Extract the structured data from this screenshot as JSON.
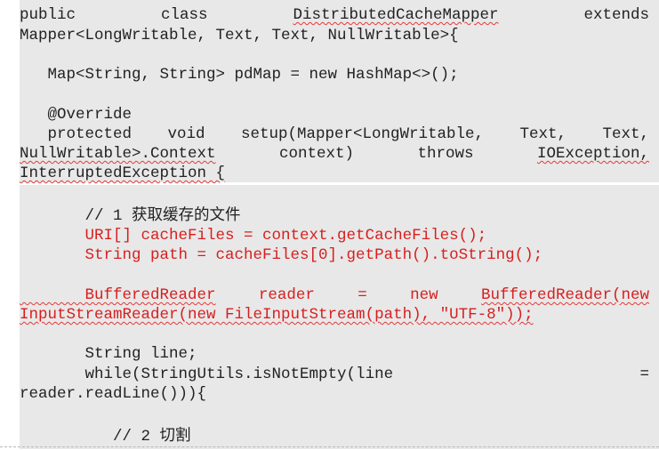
{
  "code": {
    "l1": {
      "a": "public",
      "b": "class",
      "c": "DistributedCacheMapper",
      "d": "extends"
    },
    "l2": "Mapper<LongWritable, Text, Text, NullWritable>{",
    "l3": "   Map<String, String> pdMap = new HashMap<>();",
    "l4": "   @Override",
    "l5": {
      "a": "   protected",
      "b": "void",
      "c": "setup(Mapper<LongWritable,",
      "d": "Text,",
      "e": "Text,"
    },
    "l6": {
      "a": "NullWritable>.Context",
      "b": "context)",
      "c": "throws",
      "d": "IOException,"
    },
    "l7": "InterruptedException {",
    "l8": "       // 1 获取缓存的文件",
    "l9": "       URI[] cacheFiles = context.getCacheFiles();",
    "l10": "       String path = cacheFiles[0].getPath().toString();",
    "l11": {
      "a": "       BufferedReader",
      "b": "reader",
      "c": "=",
      "d": "new",
      "e": "BufferedReader(new"
    },
    "l12": "InputStreamReader(new FileInputStream(path), \"UTF-8\"));",
    "l13": "       String line;",
    "l14": {
      "a": "       while(StringUtils.isNotEmpty(line",
      "b": "="
    },
    "l15": "reader.readLine())){",
    "l16": "          // 2 切割"
  },
  "colors": {
    "highlight": "#d81e1e",
    "background": "#e8e8e8"
  }
}
